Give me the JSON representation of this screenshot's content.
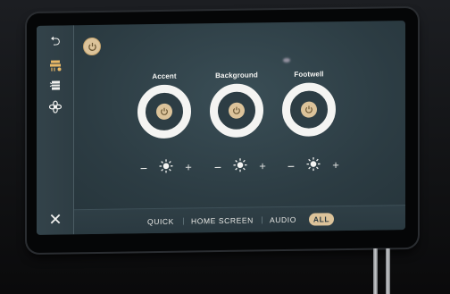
{
  "sidebar": {
    "back_icon": "back-arrow-icon",
    "seat_icon": "seat-heat-icon",
    "climate_icon": "climate-icon",
    "fan_icon": "fan-icon",
    "close_icon": "close-icon",
    "back_glyph": "⮌",
    "close_glyph": "✕"
  },
  "zones": [
    {
      "label": "Accent"
    },
    {
      "label": "Background"
    },
    {
      "label": "Footwell"
    }
  ],
  "brightness": {
    "minus": "−",
    "plus": "+"
  },
  "tabs": [
    {
      "label": "QUICK"
    },
    {
      "label": "HOME SCREEN"
    },
    {
      "label": "AUDIO"
    },
    {
      "label": "ALL",
      "active": true
    }
  ],
  "colors": {
    "accent": "#dcc39a",
    "screen_bg": "#2c3c43",
    "ring": "#f4f4f2"
  }
}
